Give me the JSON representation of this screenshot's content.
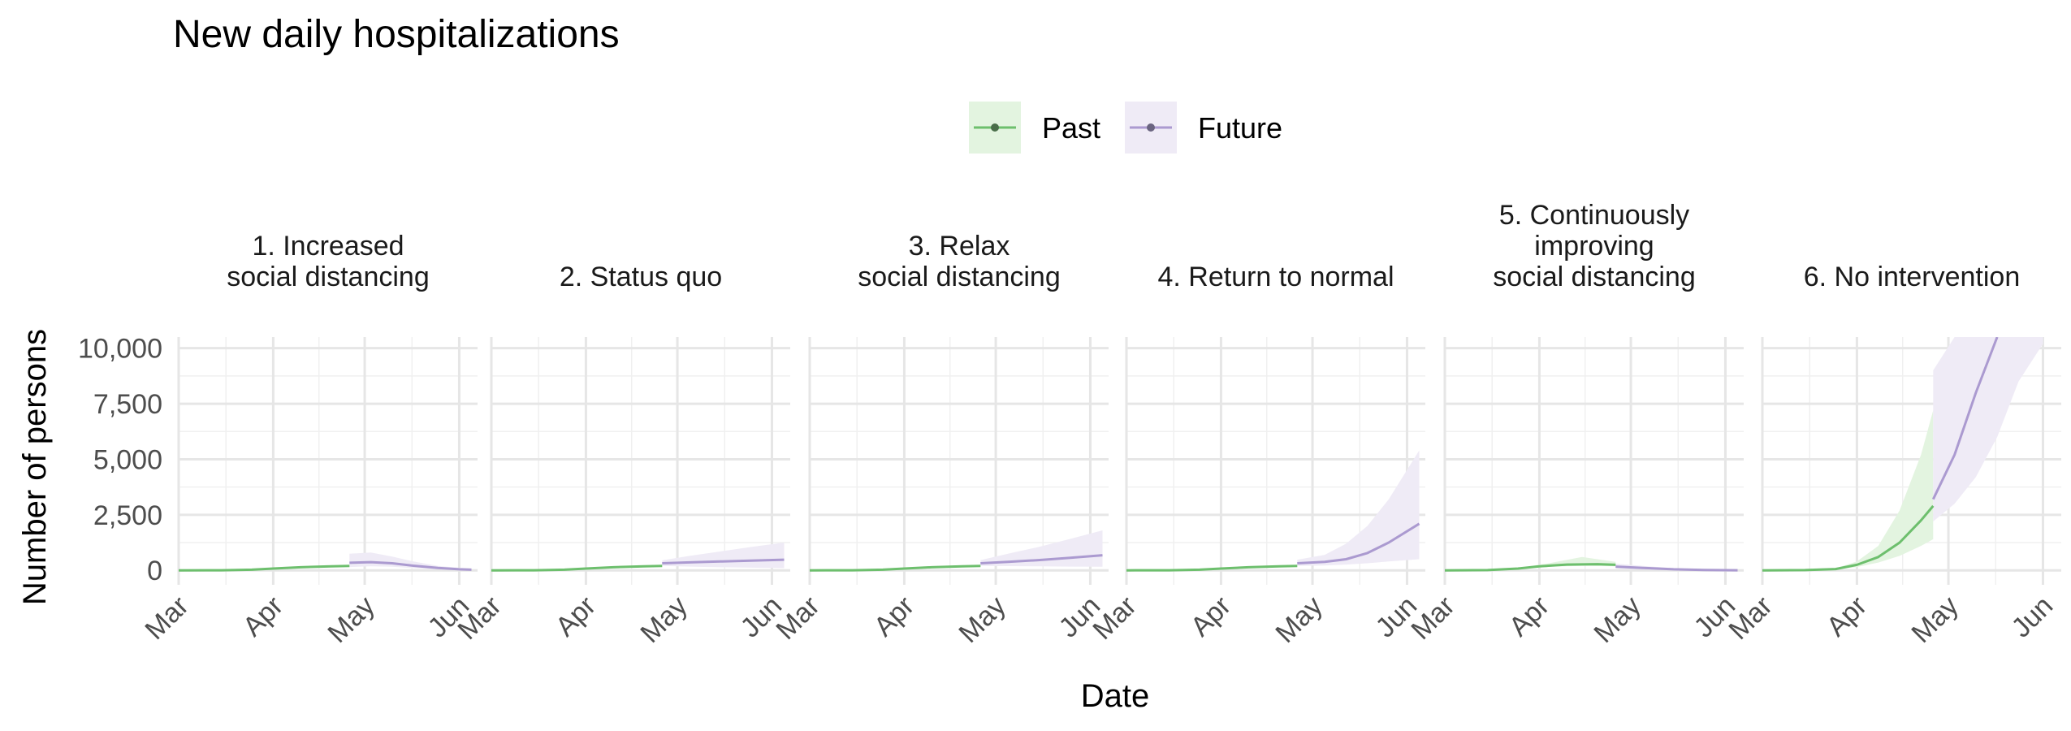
{
  "chart_data": {
    "type": "line",
    "title": "New daily hospitalizations",
    "xlabel": "Date",
    "ylabel": "Number of persons",
    "legend": {
      "position": "top",
      "entries": [
        {
          "name": "Past",
          "color": "#6dbf6d",
          "fill": "#e3f4e0"
        },
        {
          "name": "Future",
          "color": "#ab9ad0",
          "fill": "#efebf6"
        }
      ]
    },
    "x_ticks": [
      "Mar",
      "Apr",
      "May",
      "Jun"
    ],
    "x_range": [
      "2020-03-01",
      "2020-06-07"
    ],
    "y_ticks": [
      "0",
      "2,500",
      "5,000",
      "7,500",
      "10,000"
    ],
    "ylim": [
      -650,
      10500
    ],
    "grid": true,
    "panels": [
      {
        "title": [
          "1. Increased",
          "social distancing"
        ],
        "past": {
          "points": [
            [
              "2020-03-01",
              0
            ],
            [
              "2020-03-15",
              5
            ],
            [
              "2020-03-25",
              30
            ],
            [
              "2020-04-01",
              80
            ],
            [
              "2020-04-10",
              140
            ],
            [
              "2020-04-20",
              185
            ],
            [
              "2020-04-26",
              200
            ]
          ],
          "band": [
            [
              "2020-03-01",
              0,
              0
            ],
            [
              "2020-03-25",
              25,
              35
            ],
            [
              "2020-04-10",
              130,
              150
            ],
            [
              "2020-04-26",
              185,
              215
            ]
          ]
        },
        "future": {
          "points": [
            [
              "2020-04-26",
              340
            ],
            [
              "2020-05-03",
              370
            ],
            [
              "2020-05-10",
              320
            ],
            [
              "2020-05-17",
              210
            ],
            [
              "2020-05-25",
              110
            ],
            [
              "2020-06-01",
              50
            ],
            [
              "2020-06-05",
              30
            ]
          ],
          "band": [
            [
              "2020-04-26",
              150,
              750
            ],
            [
              "2020-05-03",
              180,
              800
            ],
            [
              "2020-05-10",
              160,
              620
            ],
            [
              "2020-05-17",
              100,
              400
            ],
            [
              "2020-05-25",
              50,
              200
            ],
            [
              "2020-06-05",
              10,
              70
            ]
          ]
        }
      },
      {
        "title": [
          "2. Status quo"
        ],
        "past": {
          "points": [
            [
              "2020-03-01",
              0
            ],
            [
              "2020-03-15",
              5
            ],
            [
              "2020-03-25",
              30
            ],
            [
              "2020-04-01",
              80
            ],
            [
              "2020-04-10",
              140
            ],
            [
              "2020-04-20",
              185
            ],
            [
              "2020-04-26",
              200
            ]
          ],
          "band": [
            [
              "2020-03-01",
              0,
              0
            ],
            [
              "2020-03-25",
              25,
              35
            ],
            [
              "2020-04-10",
              130,
              150
            ],
            [
              "2020-04-26",
              185,
              215
            ]
          ]
        },
        "future": {
          "points": [
            [
              "2020-04-26",
              320
            ],
            [
              "2020-05-05",
              360
            ],
            [
              "2020-05-15",
              400
            ],
            [
              "2020-05-25",
              440
            ],
            [
              "2020-06-05",
              480
            ]
          ],
          "band": [
            [
              "2020-04-26",
              200,
              450
            ],
            [
              "2020-05-05",
              170,
              650
            ],
            [
              "2020-05-15",
              140,
              850
            ],
            [
              "2020-05-25",
              120,
              1050
            ],
            [
              "2020-06-05",
              100,
              1250
            ]
          ]
        }
      },
      {
        "title": [
          "3. Relax",
          "social distancing"
        ],
        "past": {
          "points": [
            [
              "2020-03-01",
              0
            ],
            [
              "2020-03-15",
              5
            ],
            [
              "2020-03-25",
              30
            ],
            [
              "2020-04-01",
              80
            ],
            [
              "2020-04-10",
              140
            ],
            [
              "2020-04-20",
              185
            ],
            [
              "2020-04-26",
              200
            ]
          ],
          "band": [
            [
              "2020-03-01",
              0,
              0
            ],
            [
              "2020-03-25",
              25,
              35
            ],
            [
              "2020-04-10",
              130,
              150
            ],
            [
              "2020-04-26",
              185,
              215
            ]
          ]
        },
        "future": {
          "points": [
            [
              "2020-04-26",
              320
            ],
            [
              "2020-05-05",
              380
            ],
            [
              "2020-05-15",
              460
            ],
            [
              "2020-05-25",
              560
            ],
            [
              "2020-06-05",
              680
            ]
          ],
          "band": [
            [
              "2020-04-26",
              200,
              460
            ],
            [
              "2020-05-05",
              190,
              750
            ],
            [
              "2020-05-15",
              180,
              1050
            ],
            [
              "2020-05-25",
              170,
              1400
            ],
            [
              "2020-06-05",
              160,
              1800
            ]
          ]
        }
      },
      {
        "title": [
          "4. Return to normal"
        ],
        "past": {
          "points": [
            [
              "2020-03-01",
              0
            ],
            [
              "2020-03-15",
              5
            ],
            [
              "2020-03-25",
              30
            ],
            [
              "2020-04-01",
              80
            ],
            [
              "2020-04-10",
              140
            ],
            [
              "2020-04-20",
              185
            ],
            [
              "2020-04-26",
              200
            ]
          ],
          "band": [
            [
              "2020-03-01",
              0,
              0
            ],
            [
              "2020-03-25",
              25,
              35
            ],
            [
              "2020-04-10",
              130,
              150
            ],
            [
              "2020-04-26",
              185,
              215
            ]
          ]
        },
        "future": {
          "points": [
            [
              "2020-04-26",
              320
            ],
            [
              "2020-05-05",
              380
            ],
            [
              "2020-05-12",
              500
            ],
            [
              "2020-05-19",
              780
            ],
            [
              "2020-05-26",
              1250
            ],
            [
              "2020-06-05",
              2100
            ]
          ],
          "band": [
            [
              "2020-04-26",
              200,
              480
            ],
            [
              "2020-05-05",
              220,
              700
            ],
            [
              "2020-05-12",
              260,
              1200
            ],
            [
              "2020-05-19",
              320,
              2000
            ],
            [
              "2020-05-26",
              400,
              3200
            ],
            [
              "2020-06-05",
              500,
              5400
            ]
          ]
        }
      },
      {
        "title": [
          "5. Continuously",
          "improving",
          "social distancing"
        ],
        "past": {
          "points": [
            [
              "2020-03-01",
              0
            ],
            [
              "2020-03-15",
              10
            ],
            [
              "2020-03-25",
              80
            ],
            [
              "2020-04-01",
              180
            ],
            [
              "2020-04-10",
              260
            ],
            [
              "2020-04-20",
              280
            ],
            [
              "2020-04-26",
              250
            ]
          ],
          "band": [
            [
              "2020-03-01",
              0,
              0
            ],
            [
              "2020-03-25",
              50,
              110
            ],
            [
              "2020-04-05",
              170,
              340
            ],
            [
              "2020-04-15",
              200,
              600
            ],
            [
              "2020-04-26",
              180,
              380
            ]
          ]
        },
        "future": {
          "points": [
            [
              "2020-04-26",
              170
            ],
            [
              "2020-05-05",
              110
            ],
            [
              "2020-05-15",
              50
            ],
            [
              "2020-05-25",
              20
            ],
            [
              "2020-06-05",
              5
            ]
          ],
          "band": [
            [
              "2020-04-26",
              80,
              300
            ],
            [
              "2020-05-05",
              40,
              200
            ],
            [
              "2020-05-15",
              15,
              100
            ],
            [
              "2020-05-25",
              5,
              50
            ],
            [
              "2020-06-05",
              0,
              20
            ]
          ]
        }
      },
      {
        "title": [
          "6. No intervention"
        ],
        "past": {
          "points": [
            [
              "2020-03-01",
              0
            ],
            [
              "2020-03-15",
              10
            ],
            [
              "2020-03-25",
              60
            ],
            [
              "2020-04-01",
              250
            ],
            [
              "2020-04-08",
              600
            ],
            [
              "2020-04-15",
              1250
            ],
            [
              "2020-04-22",
              2250
            ],
            [
              "2020-04-26",
              2900
            ]
          ],
          "band": [
            [
              "2020-03-01",
              0,
              0
            ],
            [
              "2020-03-25",
              40,
              90
            ],
            [
              "2020-04-01",
              150,
              400
            ],
            [
              "2020-04-08",
              350,
              1100
            ],
            [
              "2020-04-15",
              650,
              2700
            ],
            [
              "2020-04-22",
              1100,
              5200
            ],
            [
              "2020-04-26",
              1400,
              7200
            ]
          ]
        },
        "future": {
          "points": [
            [
              "2020-04-26",
              3200
            ],
            [
              "2020-05-03",
              5200
            ],
            [
              "2020-05-10",
              8000
            ],
            [
              "2020-05-17",
              10500
            ]
          ],
          "band": [
            [
              "2020-04-26",
              2200,
              9000
            ],
            [
              "2020-05-03",
              3000,
              10500
            ],
            [
              "2020-05-10",
              4200,
              10500
            ],
            [
              "2020-05-17",
              6000,
              10500
            ],
            [
              "2020-05-24",
              8500,
              10500
            ],
            [
              "2020-06-01",
              10200,
              10500
            ]
          ]
        }
      }
    ]
  }
}
